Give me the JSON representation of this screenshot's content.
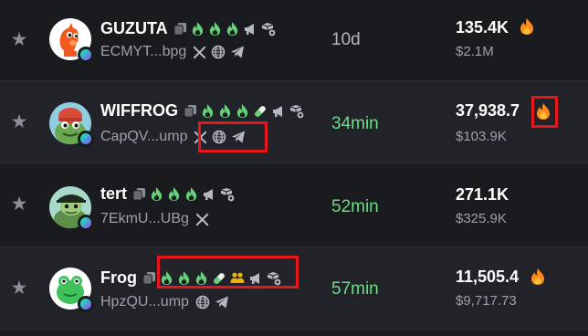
{
  "colors": {
    "background": "#1a1b1f",
    "alt_row": "#222328",
    "green_age": "#6ddc85",
    "grey_age": "#b5b6bc",
    "flame_green": "#67d17a",
    "fire": "#ff8c1a",
    "highlight": "#e5171d",
    "chain_gradient_start": "#00ffa3",
    "chain_gradient_end": "#9945ff"
  },
  "rows": [
    {
      "name": "GUZUTA",
      "address": "ECMYT...bpg",
      "age": "10d",
      "market_cap": "135.4K",
      "usd": "$2.1M",
      "badges": [
        "copy-icon",
        "flame-icon",
        "flame-icon",
        "flame-icon",
        "megaphone-icon",
        "holder-icon"
      ],
      "socials": [
        "x-icon",
        "web-icon",
        "telegram-icon"
      ]
    },
    {
      "name": "WIFFROG",
      "address": "CapQV...ump",
      "age": "34min",
      "market_cap": "37,938.7",
      "usd": "$103.9K",
      "badges": [
        "copy-icon",
        "flame-icon",
        "flame-icon",
        "flame-icon",
        "pill-icon",
        "megaphone-icon",
        "holder-icon"
      ],
      "socials": [
        "x-icon",
        "web-icon",
        "telegram-icon"
      ]
    },
    {
      "name": "tert",
      "address": "7EkmU...UBg",
      "age": "52min",
      "market_cap": "271.1K",
      "usd": "$325.9K",
      "badges": [
        "copy-icon",
        "flame-icon",
        "flame-icon",
        "flame-icon",
        "megaphone-icon",
        "holder-icon"
      ],
      "socials": [
        "x-icon"
      ]
    },
    {
      "name": "Frog",
      "address": "HpzQU...ump",
      "age": "57min",
      "market_cap": "11,505.4",
      "usd": "$9,717.73",
      "badges": [
        "copy-icon",
        "flame-icon",
        "flame-icon",
        "flame-icon",
        "pill-icon",
        "team-icon",
        "megaphone-icon",
        "holder-icon"
      ],
      "socials": [
        "web-icon",
        "telegram-icon"
      ]
    }
  ]
}
